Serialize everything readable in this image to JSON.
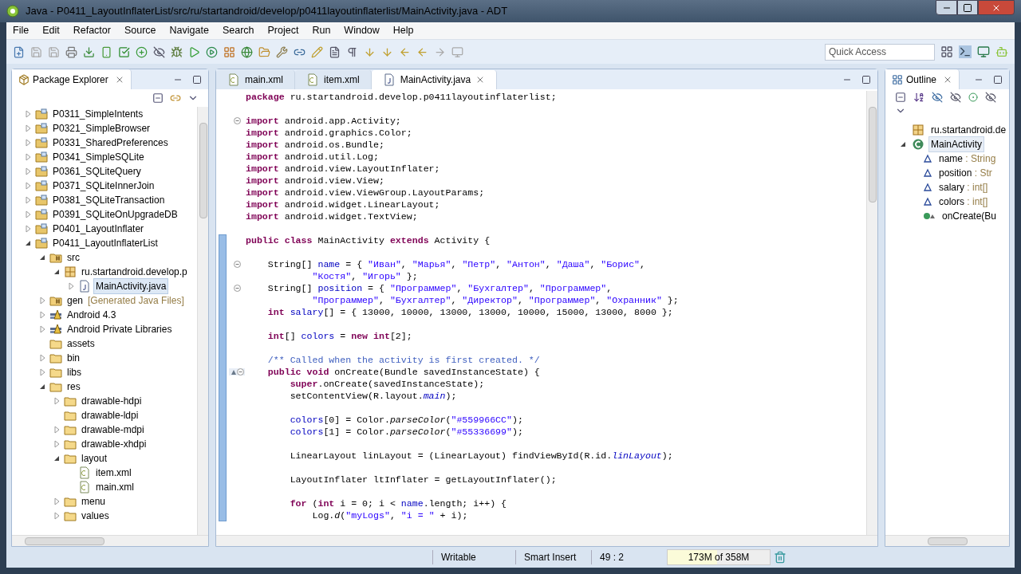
{
  "window": {
    "title": "Java - P0411_LayoutInflaterList/src/ru/startandroid/develop/p0411layoutinflaterlist/MainActivity.java - ADT"
  },
  "menu": [
    "File",
    "Edit",
    "Refactor",
    "Source",
    "Navigate",
    "Search",
    "Project",
    "Run",
    "Window",
    "Help"
  ],
  "quick_access": {
    "placeholder": "Quick Access"
  },
  "package_explorer": {
    "title": "Package Explorer",
    "tree": [
      {
        "label": "P0311_SimpleIntents",
        "kind": "project",
        "expanded": false,
        "selected": false
      },
      {
        "label": "P0321_SimpleBrowser",
        "kind": "project",
        "expanded": false,
        "selected": false
      },
      {
        "label": "P0331_SharedPreferences",
        "kind": "project",
        "expanded": false,
        "selected": false
      },
      {
        "label": "P0341_SimpleSQLite",
        "kind": "project",
        "expanded": false,
        "selected": false
      },
      {
        "label": "P0361_SQLiteQuery",
        "kind": "project",
        "expanded": false,
        "selected": false
      },
      {
        "label": "P0371_SQLiteInnerJoin",
        "kind": "project",
        "expanded": false,
        "selected": false
      },
      {
        "label": "P0381_SQLiteTransaction",
        "kind": "project",
        "expanded": false,
        "selected": false
      },
      {
        "label": "P0391_SQLiteOnUpgradeDB",
        "kind": "project",
        "expanded": false,
        "selected": false
      },
      {
        "label": "P0401_LayoutInflater",
        "kind": "project",
        "expanded": false,
        "selected": false
      },
      {
        "label": "P0411_LayoutInflaterList",
        "kind": "project",
        "expanded": true,
        "selected": false,
        "children": [
          {
            "label": "src",
            "kind": "srcfolder",
            "expanded": true,
            "selected": false,
            "children": [
              {
                "label": "ru.startandroid.develop.p",
                "kind": "package",
                "expanded": true,
                "selected": false,
                "children": [
                  {
                    "label": "MainActivity.java",
                    "kind": "java",
                    "expanded": false,
                    "selected": true
                  }
                ]
              }
            ]
          },
          {
            "label": "gen",
            "decoration": "[Generated Java Files]",
            "kind": "srcfolder",
            "expanded": false,
            "selected": false
          },
          {
            "label": "Android 4.3",
            "kind": "library",
            "expanded": false,
            "selected": false
          },
          {
            "label": "Android Private Libraries",
            "kind": "library",
            "expanded": false,
            "selected": false
          },
          {
            "label": "assets",
            "kind": "folder",
            "selected": false
          },
          {
            "label": "bin",
            "kind": "folder",
            "expanded": false,
            "selected": false
          },
          {
            "label": "libs",
            "kind": "folder",
            "expanded": false,
            "selected": false
          },
          {
            "label": "res",
            "kind": "folder",
            "expanded": true,
            "selected": false,
            "children": [
              {
                "label": "drawable-hdpi",
                "kind": "folder",
                "expanded": false,
                "selected": false
              },
              {
                "label": "drawable-ldpi",
                "kind": "folder",
                "selected": false
              },
              {
                "label": "drawable-mdpi",
                "kind": "folder",
                "expanded": false,
                "selected": false
              },
              {
                "label": "drawable-xhdpi",
                "kind": "folder",
                "expanded": false,
                "selected": false
              },
              {
                "label": "layout",
                "kind": "folder",
                "expanded": true,
                "selected": false,
                "children": [
                  {
                    "label": "item.xml",
                    "kind": "xml",
                    "selected": false
                  },
                  {
                    "label": "main.xml",
                    "kind": "xml",
                    "selected": false
                  }
                ]
              },
              {
                "label": "menu",
                "kind": "folder",
                "expanded": false,
                "selected": false
              },
              {
                "label": "values",
                "kind": "folder",
                "expanded": false,
                "selected": false
              }
            ]
          }
        ]
      }
    ]
  },
  "editor": {
    "tabs": [
      {
        "label": "main.xml",
        "kind": "xml",
        "selected": false
      },
      {
        "label": "item.xml",
        "kind": "xml",
        "selected": false
      },
      {
        "label": "MainActivity.java",
        "kind": "java",
        "selected": true
      }
    ],
    "lines": [
      {
        "kind": "code",
        "tokens": [
          {
            "kind": "kw",
            "text": "package"
          },
          {
            "kind": "plain",
            "text": " ru.startandroid.develop.p0411layoutinflaterlist;"
          }
        ]
      },
      {
        "kind": "blank"
      },
      {
        "kind": "code",
        "fold": true,
        "tokens": [
          {
            "kind": "kw",
            "text": "import"
          },
          {
            "kind": "plain",
            "text": " android.app.Activity;"
          }
        ]
      },
      {
        "kind": "code",
        "tokens": [
          {
            "kind": "kw",
            "text": "import"
          },
          {
            "kind": "plain",
            "text": " android.graphics.Color;"
          }
        ]
      },
      {
        "kind": "code",
        "tokens": [
          {
            "kind": "kw",
            "text": "import"
          },
          {
            "kind": "plain",
            "text": " android.os.Bundle;"
          }
        ]
      },
      {
        "kind": "code",
        "tokens": [
          {
            "kind": "kw",
            "text": "import"
          },
          {
            "kind": "plain",
            "text": " android.util.Log;"
          }
        ]
      },
      {
        "kind": "code",
        "tokens": [
          {
            "kind": "kw",
            "text": "import"
          },
          {
            "kind": "plain",
            "text": " android.view.LayoutInflater;"
          }
        ]
      },
      {
        "kind": "code",
        "tokens": [
          {
            "kind": "kw",
            "text": "import"
          },
          {
            "kind": "plain",
            "text": " android.view.View;"
          }
        ]
      },
      {
        "kind": "code",
        "tokens": [
          {
            "kind": "kw",
            "text": "import"
          },
          {
            "kind": "plain",
            "text": " android.view.ViewGroup.LayoutParams;"
          }
        ]
      },
      {
        "kind": "code",
        "tokens": [
          {
            "kind": "kw",
            "text": "import"
          },
          {
            "kind": "plain",
            "text": " android.widget.LinearLayout;"
          }
        ]
      },
      {
        "kind": "code",
        "tokens": [
          {
            "kind": "kw",
            "text": "import"
          },
          {
            "kind": "plain",
            "text": " android.widget.TextView;"
          }
        ]
      },
      {
        "kind": "blank"
      },
      {
        "kind": "code",
        "tokens": [
          {
            "kind": "kw",
            "text": "public class"
          },
          {
            "kind": "plain",
            "text": " MainActivity "
          },
          {
            "kind": "kw",
            "text": "extends"
          },
          {
            "kind": "plain",
            "text": " Activity {"
          }
        ]
      },
      {
        "kind": "blank"
      },
      {
        "kind": "code",
        "fold": true,
        "tokens": [
          {
            "kind": "plain",
            "text": "    String[] "
          },
          {
            "kind": "field",
            "text": "name"
          },
          {
            "kind": "plain",
            "text": " = { "
          },
          {
            "kind": "str",
            "text": "\"Иван\""
          },
          {
            "kind": "plain",
            "text": ", "
          },
          {
            "kind": "str",
            "text": "\"Марья\""
          },
          {
            "kind": "plain",
            "text": ", "
          },
          {
            "kind": "str",
            "text": "\"Петр\""
          },
          {
            "kind": "plain",
            "text": ", "
          },
          {
            "kind": "str",
            "text": "\"Антон\""
          },
          {
            "kind": "plain",
            "text": ", "
          },
          {
            "kind": "str",
            "text": "\"Даша\""
          },
          {
            "kind": "plain",
            "text": ", "
          },
          {
            "kind": "str",
            "text": "\"Борис\""
          },
          {
            "kind": "plain",
            "text": ","
          }
        ]
      },
      {
        "kind": "code",
        "tokens": [
          {
            "kind": "str",
            "text": "            \"Костя\""
          },
          {
            "kind": "plain",
            "text": ", "
          },
          {
            "kind": "str",
            "text": "\"Игорь\""
          },
          {
            "kind": "plain",
            "text": " };"
          }
        ]
      },
      {
        "kind": "code",
        "fold": true,
        "tokens": [
          {
            "kind": "plain",
            "text": "    String[] "
          },
          {
            "kind": "field",
            "text": "position"
          },
          {
            "kind": "plain",
            "text": " = { "
          },
          {
            "kind": "str",
            "text": "\"Программер\""
          },
          {
            "kind": "plain",
            "text": ", "
          },
          {
            "kind": "str",
            "text": "\"Бухгалтер\""
          },
          {
            "kind": "plain",
            "text": ", "
          },
          {
            "kind": "str",
            "text": "\"Программер\""
          },
          {
            "kind": "plain",
            "text": ","
          }
        ]
      },
      {
        "kind": "code",
        "tokens": [
          {
            "kind": "str",
            "text": "            \"Программер\""
          },
          {
            "kind": "plain",
            "text": ", "
          },
          {
            "kind": "str",
            "text": "\"Бухгалтер\""
          },
          {
            "kind": "plain",
            "text": ", "
          },
          {
            "kind": "str",
            "text": "\"Директор\""
          },
          {
            "kind": "plain",
            "text": ", "
          },
          {
            "kind": "str",
            "text": "\"Программер\""
          },
          {
            "kind": "plain",
            "text": ", "
          },
          {
            "kind": "str",
            "text": "\"Охранник\""
          },
          {
            "kind": "plain",
            "text": " };"
          }
        ]
      },
      {
        "kind": "code",
        "tokens": [
          {
            "kind": "kw",
            "text": "    int"
          },
          {
            "kind": "field",
            "text": " salary"
          },
          {
            "kind": "plain",
            "text": "[] = { 13000, 10000, 13000, 13000, 10000, 15000, 13000, 8000 };"
          }
        ]
      },
      {
        "kind": "blank"
      },
      {
        "kind": "code",
        "tokens": [
          {
            "kind": "kw",
            "text": "    int"
          },
          {
            "kind": "plain",
            "text": "[] "
          },
          {
            "kind": "field",
            "text": "colors"
          },
          {
            "kind": "plain",
            "text": " = "
          },
          {
            "kind": "kw",
            "text": "new int"
          },
          {
            "kind": "plain",
            "text": "[2];"
          }
        ]
      },
      {
        "kind": "blank"
      },
      {
        "kind": "code",
        "tokens": [
          {
            "kind": "comment",
            "text": "    /** Called when the activity is first created. */"
          }
        ]
      },
      {
        "kind": "code",
        "fold": true,
        "override": true,
        "tokens": [
          {
            "kind": "kw",
            "text": "    public void"
          },
          {
            "kind": "plain",
            "text": " onCreate(Bundle savedInstanceState) {"
          }
        ]
      },
      {
        "kind": "code",
        "tokens": [
          {
            "kind": "kw",
            "text": "        super"
          },
          {
            "kind": "plain",
            "text": ".onCreate(savedInstanceState);"
          }
        ]
      },
      {
        "kind": "code",
        "tokens": [
          {
            "kind": "plain",
            "text": "        setContentView(R.layout."
          },
          {
            "kind": "static_field",
            "text": "main"
          },
          {
            "kind": "plain",
            "text": ");"
          }
        ]
      },
      {
        "kind": "blank"
      },
      {
        "kind": "code",
        "tokens": [
          {
            "kind": "field",
            "text": "        colors"
          },
          {
            "kind": "plain",
            "text": "[0] = Color."
          },
          {
            "kind": "static_method",
            "text": "parseColor"
          },
          {
            "kind": "plain",
            "text": "("
          },
          {
            "kind": "str",
            "text": "\"#559966CC\""
          },
          {
            "kind": "plain",
            "text": ");"
          }
        ]
      },
      {
        "kind": "code",
        "tokens": [
          {
            "kind": "field",
            "text": "        colors"
          },
          {
            "kind": "plain",
            "text": "[1] = Color."
          },
          {
            "kind": "static_method",
            "text": "parseColor"
          },
          {
            "kind": "plain",
            "text": "("
          },
          {
            "kind": "str",
            "text": "\"#55336699\""
          },
          {
            "kind": "plain",
            "text": ");"
          }
        ]
      },
      {
        "kind": "blank"
      },
      {
        "kind": "code",
        "tokens": [
          {
            "kind": "plain",
            "text": "        LinearLayout linLayout = (LinearLayout) findViewById(R.id."
          },
          {
            "kind": "static_field",
            "text": "linLayout"
          },
          {
            "kind": "plain",
            "text": ");"
          }
        ]
      },
      {
        "kind": "blank"
      },
      {
        "kind": "code",
        "tokens": [
          {
            "kind": "plain",
            "text": "        LayoutInflater ltInflater = getLayoutInflater();"
          }
        ]
      },
      {
        "kind": "blank"
      },
      {
        "kind": "code",
        "tokens": [
          {
            "kind": "kw",
            "text": "        for"
          },
          {
            "kind": "plain",
            "text": " ("
          },
          {
            "kind": "kw",
            "text": "int"
          },
          {
            "kind": "plain",
            "text": " i = 0; i < "
          },
          {
            "kind": "field",
            "text": "name"
          },
          {
            "kind": "plain",
            "text": ".length; i++) {"
          }
        ]
      },
      {
        "kind": "code",
        "tokens": [
          {
            "kind": "plain",
            "text": "            Log."
          },
          {
            "kind": "static_method",
            "text": "d"
          },
          {
            "kind": "plain",
            "text": "("
          },
          {
            "kind": "str",
            "text": "\"myLogs\""
          },
          {
            "kind": "plain",
            "text": ", "
          },
          {
            "kind": "str",
            "text": "\"i = \""
          },
          {
            "kind": "plain",
            "text": " + i);"
          }
        ]
      }
    ]
  },
  "outline": {
    "title": "Outline",
    "items": [
      {
        "label": "ru.startandroid.de",
        "kind": "package",
        "selected": false
      },
      {
        "label": "MainActivity",
        "kind": "class",
        "expanded": true,
        "selected": true,
        "children": [
          {
            "label": "name",
            "type": " : String",
            "kind": "field",
            "selected": false
          },
          {
            "label": "position",
            "type": " : Str",
            "kind": "field",
            "selected": false
          },
          {
            "label": "salary",
            "type": " : int[]",
            "kind": "field",
            "selected": false
          },
          {
            "label": "colors",
            "type": " : int[]",
            "kind": "field",
            "selected": false
          },
          {
            "label": "onCreate(Bu",
            "kind": "method",
            "selected": false
          }
        ]
      }
    ]
  },
  "status_bar": {
    "writable": "Writable",
    "insert_mode": "Smart Insert",
    "position": "49 : 2",
    "memory": {
      "text": "173M of 358M",
      "level": 0.483
    }
  }
}
